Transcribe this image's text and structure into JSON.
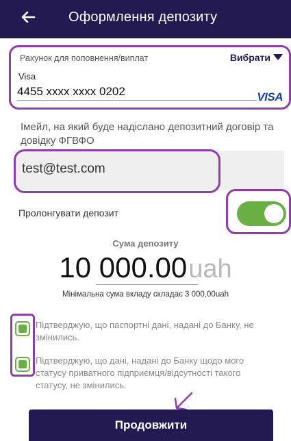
{
  "header": {
    "title": "Оформлення депозиту"
  },
  "account": {
    "label": "Рахунок для поповнення/виплат",
    "choose_label": "Вибрати",
    "card_type": "Visa",
    "card_number": "4455 xxxx xxxx 0202",
    "logo_text": "VISA"
  },
  "email": {
    "label": "Імейл, на який буде надіслано депозитний договір та довідку ФГВФО",
    "value": "test@test.com"
  },
  "prolong": {
    "label": "Пролонгувати депозит",
    "enabled": true
  },
  "deposit": {
    "sum_label": "Сума депозиту",
    "amount": "10 000.00",
    "currency": "uah",
    "min_note": "Мінімальна сума вкладу складає 3 000,00uah"
  },
  "consents": [
    {
      "text": "Підтверджую, що паспортні дані, надані до Банку, не змінились.",
      "checked": true
    },
    {
      "text": "Підтверджую, що дані, надані до Банку щодо мого статусу приватного підприємця/відсутності такого статусу, не змінились.",
      "checked": true
    }
  ],
  "continue_label": "Продовжити",
  "colors": {
    "brand": "#241a52",
    "accent_green": "#6aaf44",
    "annotation": "#8e3ea8"
  }
}
